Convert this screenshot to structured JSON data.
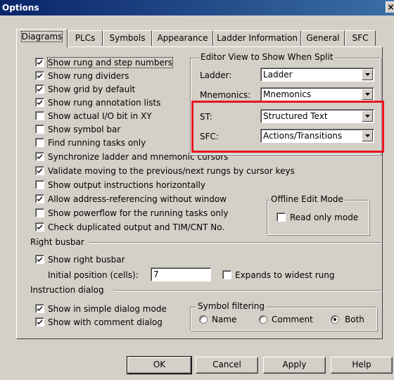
{
  "window": {
    "title": "Options",
    "close_label": "×"
  },
  "tabs": [
    {
      "label": "Diagrams",
      "active": true
    },
    {
      "label": "PLCs"
    },
    {
      "label": "Symbols"
    },
    {
      "label": "Appearance"
    },
    {
      "label": "Ladder Information"
    },
    {
      "label": "General"
    },
    {
      "label": "SFC"
    }
  ],
  "diagram_options": [
    {
      "label": "Show rung and step numbers",
      "checked": true
    },
    {
      "label": "Show rung dividers",
      "checked": true
    },
    {
      "label": "Show grid by default",
      "checked": true
    },
    {
      "label": "Show rung annotation lists",
      "checked": true
    },
    {
      "label": "Show actual I/O bit in XY",
      "checked": false
    },
    {
      "label": "Show symbol bar",
      "checked": false
    },
    {
      "label": "Find running tasks only",
      "checked": false
    },
    {
      "label": "Synchronize ladder and mnemonic cursors",
      "checked": true
    },
    {
      "label": "Validate moving to the previous/next rungs by cursor keys",
      "checked": true
    },
    {
      "label": "Show output instructions horizontally",
      "checked": false
    },
    {
      "label": "Allow address-referencing without window",
      "checked": true
    },
    {
      "label": "Show powerflow for the running tasks only",
      "checked": false
    },
    {
      "label": "Check duplicated output and TIM/CNT No.",
      "checked": true
    }
  ],
  "editor_view": {
    "title": "Editor View to Show When Split",
    "ladder_label": "Ladder:",
    "ladder_value": "Ladder",
    "mnemonics_label": "Mnemonics:",
    "mnemonics_value": "Mnemonics",
    "st_label": "ST:",
    "st_value": "Structured Text",
    "sfc_label": "SFC:",
    "sfc_value": "Actions/Transitions"
  },
  "offline_edit": {
    "title": "Offline Edit Mode",
    "read_only_label": "Read only mode",
    "read_only_checked": false
  },
  "right_busbar": {
    "title": "Right busbar",
    "show_label": "Show right busbar",
    "show_checked": true,
    "initial_position_label": "Initial position (cells):",
    "initial_position_value": "7",
    "expands_label": "Expands to widest rung",
    "expands_checked": false
  },
  "instruction_dialog": {
    "title": "Instruction dialog",
    "simple_label": "Show in simple dialog mode",
    "simple_checked": true,
    "comment_label": "Show with comment dialog",
    "comment_checked": true
  },
  "symbol_filtering": {
    "title": "Symbol filtering",
    "options": [
      "Name",
      "Comment",
      "Both"
    ],
    "selected": "Both"
  },
  "buttons": {
    "ok": "OK",
    "cancel": "Cancel",
    "apply": "Apply",
    "help": "Help"
  },
  "colors": {
    "title_gradient_start": "#0a246a",
    "title_gradient_end": "#3a6ea5",
    "dialog_face": "#d4d0c8",
    "highlight_box": "#e8141e"
  },
  "icons": {
    "check": "check-mark-icon",
    "dropdown": "triangle-down-icon",
    "close": "close-x-icon"
  }
}
